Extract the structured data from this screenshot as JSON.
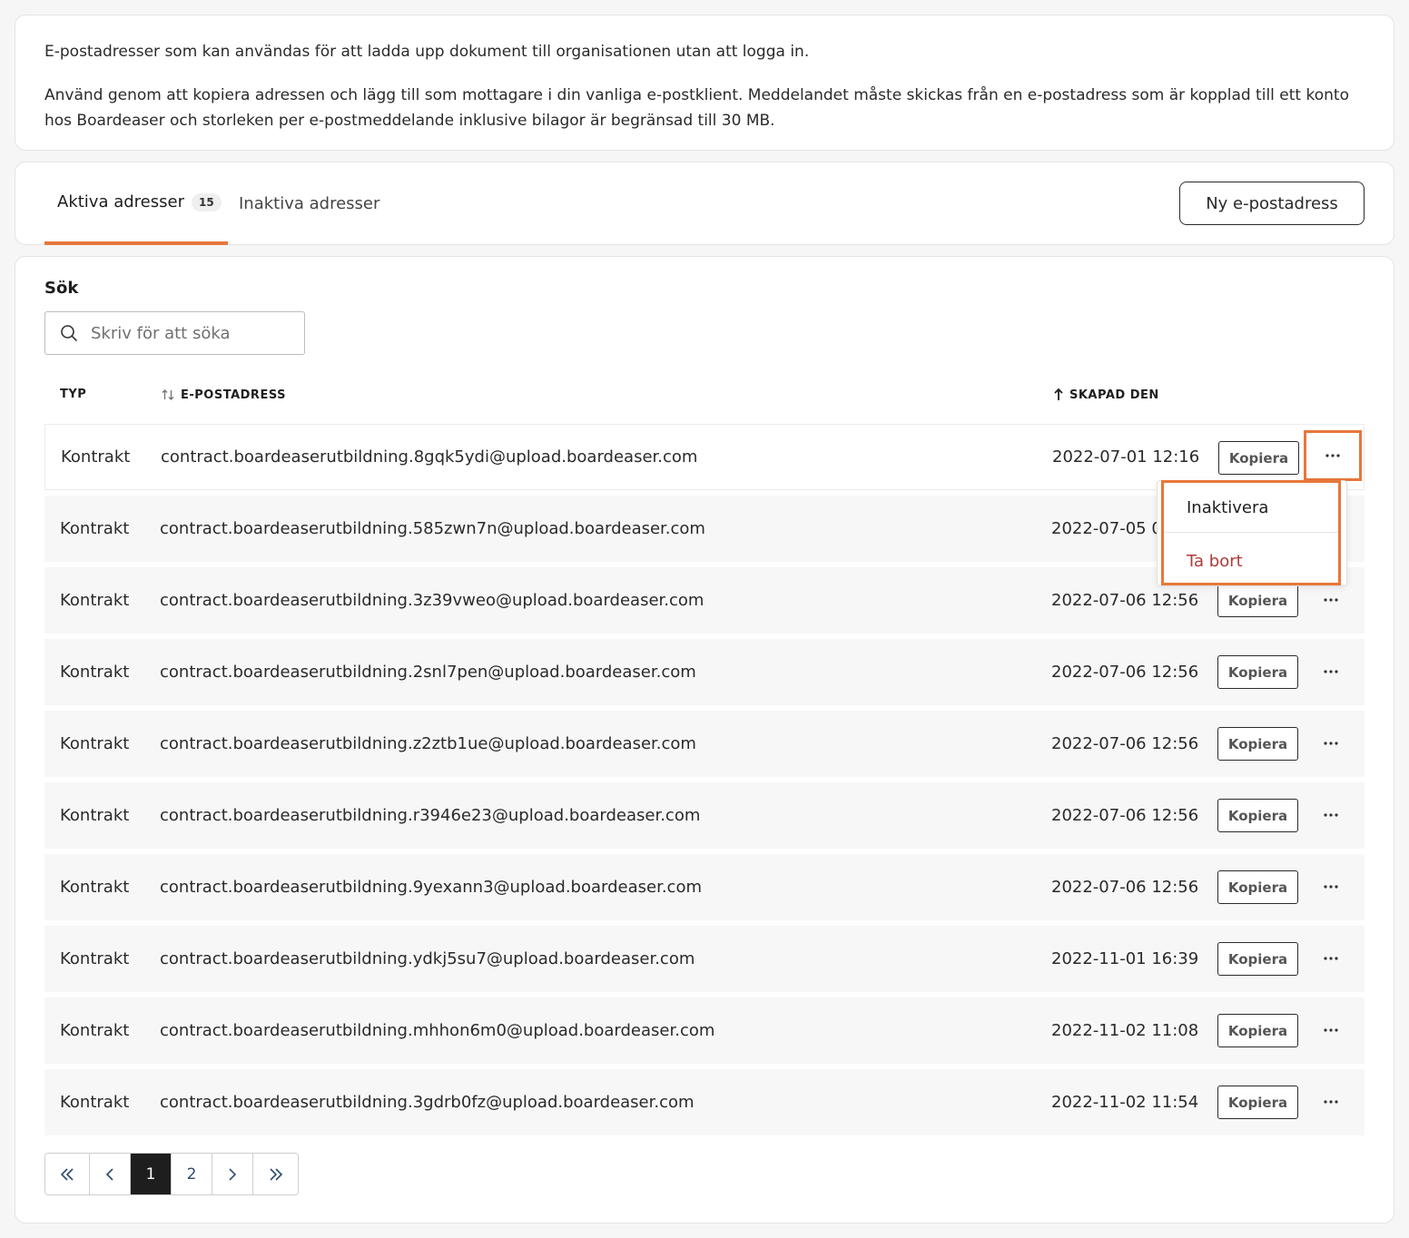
{
  "info": {
    "paragraph1": "E-postadresser som kan användas för att ladda upp dokument till organisationen utan att logga in.",
    "paragraph2": "Använd genom att kopiera adressen och lägg till som mottagare i din vanliga e-postklient. Meddelandet måste skickas från en e-postadress som är kopplad till ett konto hos Boardeaser och storleken per e-postmeddelande inklusive bilagor är begränsad till 30 MB."
  },
  "tabs": {
    "active_label": "Aktiva adresser",
    "active_count": "15",
    "inactive_label": "Inaktiva adresser",
    "new_button": "Ny e-postadress"
  },
  "search": {
    "label": "Sök",
    "placeholder": "Skriv för att söka",
    "value": ""
  },
  "table": {
    "headers": {
      "type": "TYP",
      "email": "E-POSTADRESS",
      "created": "SKAPAD DEN"
    },
    "copy_label": "Kopiera",
    "rows": [
      {
        "type": "Kontrakt",
        "email": "contract.boardeaserutbildning.8gqk5ydi@upload.boardeaser.com",
        "created": "2022-07-01 12:16"
      },
      {
        "type": "Kontrakt",
        "email": "contract.boardeaserutbildning.585zwn7n@upload.boardeaser.com",
        "created": "2022-07-05 0"
      },
      {
        "type": "Kontrakt",
        "email": "contract.boardeaserutbildning.3z39vweo@upload.boardeaser.com",
        "created": "2022-07-06 12:56"
      },
      {
        "type": "Kontrakt",
        "email": "contract.boardeaserutbildning.2snl7pen@upload.boardeaser.com",
        "created": "2022-07-06 12:56"
      },
      {
        "type": "Kontrakt",
        "email": "contract.boardeaserutbildning.z2ztb1ue@upload.boardeaser.com",
        "created": "2022-07-06 12:56"
      },
      {
        "type": "Kontrakt",
        "email": "contract.boardeaserutbildning.r3946e23@upload.boardeaser.com",
        "created": "2022-07-06 12:56"
      },
      {
        "type": "Kontrakt",
        "email": "contract.boardeaserutbildning.9yexann3@upload.boardeaser.com",
        "created": "2022-07-06 12:56"
      },
      {
        "type": "Kontrakt",
        "email": "contract.boardeaserutbildning.ydkj5su7@upload.boardeaser.com",
        "created": "2022-11-01 16:39"
      },
      {
        "type": "Kontrakt",
        "email": "contract.boardeaserutbildning.mhhon6m0@upload.boardeaser.com",
        "created": "2022-11-02 11:08"
      },
      {
        "type": "Kontrakt",
        "email": "contract.boardeaserutbildning.3gdrb0fz@upload.boardeaser.com",
        "created": "2022-11-02 11:54"
      }
    ]
  },
  "menu": {
    "inactivate": "Inaktivera",
    "delete": "Ta bort"
  },
  "pagination": {
    "pages": [
      "1",
      "2"
    ],
    "current": "1"
  },
  "colors": {
    "accent": "#e8773a",
    "danger": "#b03a3a",
    "page_link": "#2c4a6e"
  }
}
